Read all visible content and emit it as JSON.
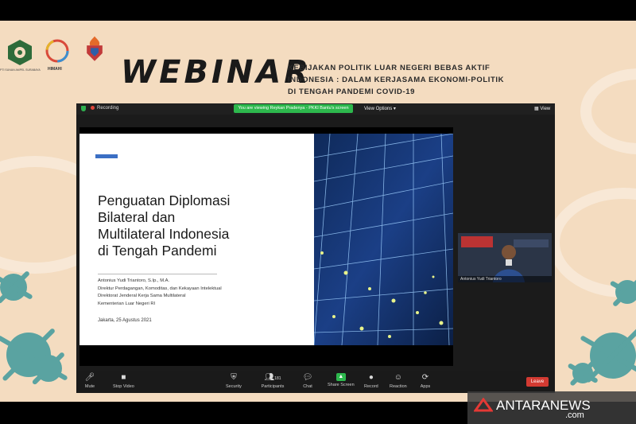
{
  "header": {
    "title": "WEBINAR",
    "subtitle_lines": [
      "KEBIJAKAN POLITIK LUAR NEGERI BEBAS AKTIF",
      "INDONESIA : DALAM KERJASAMA EKONOMI-POLITIK",
      "DI TENGAH PANDEMI COVID-19"
    ],
    "logo1_caption": "PTI SUNAN AMPEL SURABAYA",
    "logo2_caption": "HIMAHI"
  },
  "zoom": {
    "recording_label": "Recording",
    "viewing_banner": "You are viewing Reykan Pradenya - PKKI Bantu's screen",
    "view_options": "View Options ▾",
    "view_button": "View",
    "participant_name": "Antonius Yudi Triantoro",
    "participant_count": "181",
    "toolbar": [
      {
        "label": "Mute",
        "icon": "mic-icon"
      },
      {
        "label": "Stop Video",
        "icon": "video-icon"
      },
      {
        "label": "Security",
        "icon": "shield-icon"
      },
      {
        "label": "Participants",
        "icon": "participants-icon"
      },
      {
        "label": "Chat",
        "icon": "chat-icon"
      },
      {
        "label": "Share Screen",
        "icon": "share-screen-icon"
      },
      {
        "label": "Record",
        "icon": "record-icon"
      },
      {
        "label": "Reaction",
        "icon": "reaction-icon"
      },
      {
        "label": "Apps",
        "icon": "apps-icon"
      }
    ],
    "leave_label": "Leave"
  },
  "slide": {
    "title_lines": [
      "Penguatan Diplomasi",
      "Bilateral dan",
      "Multilateral Indonesia",
      "di Tengah Pandemi"
    ],
    "meta_lines": [
      "Antonius Yudi Triantoro, S.Ip., M.A.",
      "Direktur Perdagangan, Komoditas, dan Kekayaan Intelektual",
      "Direktorat Jenderal Kerja Sama Multilateral",
      "Kementerian Luar Negeri RI"
    ],
    "date": "Jakarta, 25 Agustus 2021"
  },
  "watermark": {
    "brand": "ANTARANEWS",
    "suffix": ".com"
  },
  "colors": {
    "background": "#f4dcc0",
    "virus": "#5aa3a1",
    "accent_blue": "#3b6fc4",
    "zoom_green": "#2db84d",
    "leave_red": "#d23a32"
  }
}
